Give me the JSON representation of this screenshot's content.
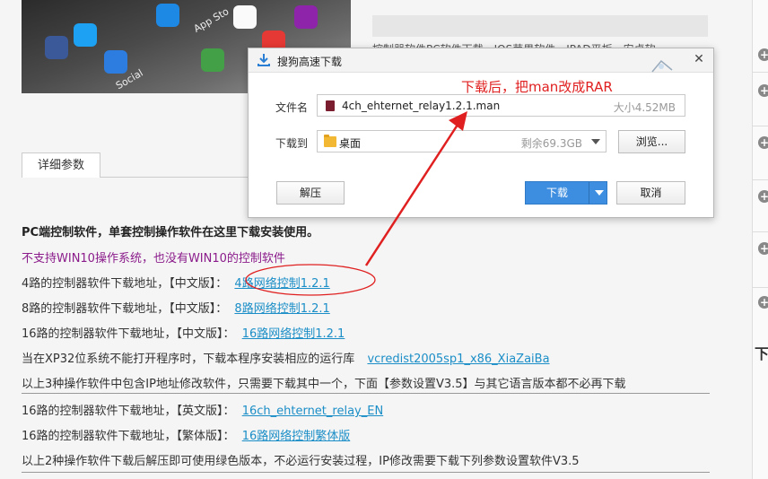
{
  "hero": {
    "label_app": "App Sto",
    "label_social": "Social"
  },
  "right_text": "控制器软件PC软件下载，IOS苹果软件，IPAD平板，安卓软",
  "tabs": [
    {
      "label": "详细参数"
    }
  ],
  "content": {
    "lines": [
      {
        "text": "PC端控制软件，单套控制操作软件在这里下载安装使用。",
        "style": "bold"
      },
      {
        "text": "不支持WIN10操作系统，也没有WIN10的控制软件",
        "style": "purple"
      },
      {
        "prefix": "4路的控制器软件下载地址，【中文版】：",
        "link": "4路网络控制1.2.1"
      },
      {
        "prefix": "8路的控制器软件下载地址，【中文版】：",
        "link": "8路网络控制1.2.1"
      },
      {
        "prefix": "16路的控制器软件下载地址，【中文版】：",
        "link": "16路网络控制1.2.1"
      },
      {
        "prefix": "当在XP32位系统不能打开程序时，下载本程序安装相应的运行库",
        "link": "vcredist2005sp1_x86_XiaZaiBa"
      },
      {
        "text": "以上3种操作软件中包含IP地址修改软件，只需要下载其中一个，下面【参数设置V3.5】与其它语言版本都不必再下载",
        "style": "normal"
      },
      {
        "prefix": "16路的控制器软件下载地址，【英文版】：",
        "link": "16ch_ehternet_relay_EN"
      },
      {
        "prefix": "16路的控制器软件下载地址，【繁体版】：",
        "link": "16路网络控制繁体版"
      },
      {
        "text": "以上2种操作软件下载后解压即可使用绿色版本，不必运行安装过程，IP修改需要下载下列参数设置软件V3.5",
        "style": "normal"
      }
    ]
  },
  "sidebar": {
    "heading": "下"
  },
  "dialog": {
    "title": "搜狗高速下载",
    "close_icon": "✕",
    "filename_label": "文件名",
    "filename": "4ch_ehternet_relay1.2.1.man",
    "size": "大小4.52MB",
    "saveto_label": "下载到",
    "folder": "桌面",
    "free_space": "剩余69.3GB",
    "browse_label": "浏览...",
    "extract_label": "解压",
    "download_label": "下载",
    "cancel_label": "取消"
  },
  "annotation": {
    "text": "下载后，把man改成RAR",
    "color": "#e02020"
  },
  "colors": {
    "link": "#1b8ec7",
    "purple": "#8b1c8b",
    "primary": "#3d8ee0"
  }
}
